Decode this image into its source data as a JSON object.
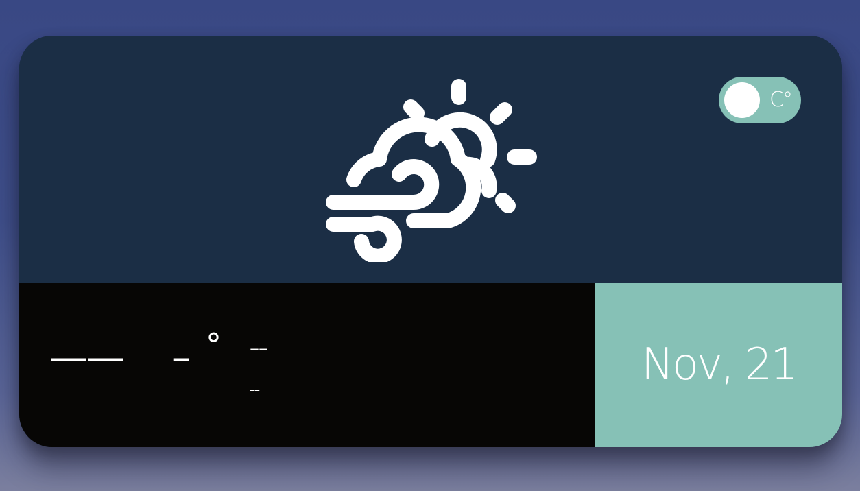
{
  "weather": {
    "condition_icon": "windy-partly-cloudy-icon"
  },
  "unit_toggle": {
    "label": "C°",
    "state": "celsius"
  },
  "readout": {
    "location": "——",
    "temperature": "–",
    "degree_symbol": "°",
    "high": "––",
    "low": "––"
  },
  "date": {
    "text": "Nov, 21"
  },
  "colors": {
    "background": "#3f4f8a",
    "card_top": "#1b2e45",
    "card_bottom_left": "#070605",
    "accent": "#86c1b6",
    "text": "#ffffff"
  }
}
